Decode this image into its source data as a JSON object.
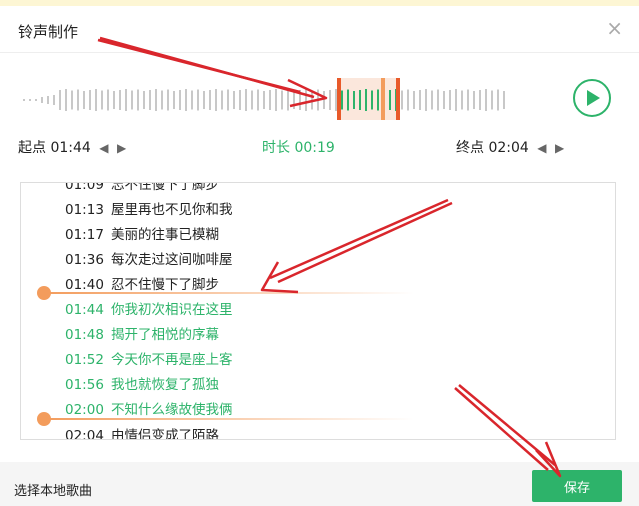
{
  "dialog": {
    "title": "铃声制作",
    "close_glyph": "×"
  },
  "editor": {
    "start_label": "起点",
    "start_time": "01:44",
    "duration_label": "时长",
    "duration": "00:19",
    "end_label": "终点",
    "end_time": "02:04",
    "arrow_left": "◀",
    "arrow_right": "▶"
  },
  "lyrics": [
    {
      "time": "01:13",
      "text": "屋里再也不见你和我",
      "selected": false
    },
    {
      "time": "01:17",
      "text": "美丽的往事已模糊",
      "selected": false
    },
    {
      "time": "01:36",
      "text": "每次走过这间咖啡屋",
      "selected": false
    },
    {
      "time": "01:40",
      "text": "忍不住慢下了脚步",
      "selected": false
    },
    {
      "time": "01:44",
      "text": "你我初次相识在这里",
      "selected": true
    },
    {
      "time": "01:48",
      "text": "揭开了相悦的序幕",
      "selected": true
    },
    {
      "time": "01:52",
      "text": "今天你不再是座上客",
      "selected": true
    },
    {
      "time": "01:56",
      "text": "我也就恢复了孤独",
      "selected": true
    },
    {
      "time": "02:00",
      "text": "不知什么缘故使我俩",
      "selected": true
    },
    {
      "time": "02:04",
      "text": "由情侣变成了陌路",
      "selected": false
    }
  ],
  "footer": {
    "local_song": "选择本地歌曲",
    "save_label": "保存"
  },
  "colors": {
    "accent": "#2db36a",
    "handle": "#e85a2a",
    "marker": "#f39c5c",
    "annotation": "#d9262c"
  },
  "icons": {
    "play": "play-icon",
    "close": "close-icon"
  }
}
